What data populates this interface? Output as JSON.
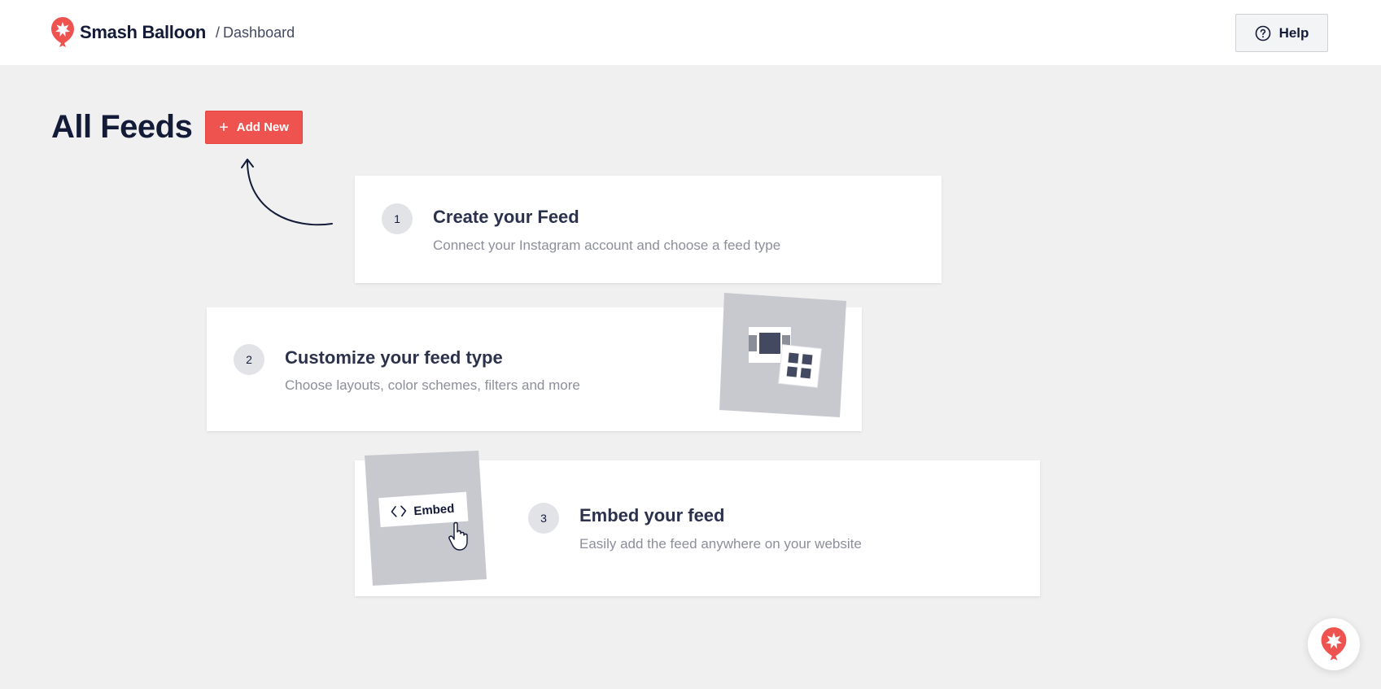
{
  "header": {
    "brand": "Smash Balloon",
    "separator": "/",
    "breadcrumb": "Dashboard",
    "help_label": "Help"
  },
  "main": {
    "title": "All Feeds",
    "add_new_label": "Add New"
  },
  "steps": [
    {
      "number": "1",
      "title": "Create your Feed",
      "description": "Connect your Instagram account and choose a feed type"
    },
    {
      "number": "2",
      "title": "Customize your feed type",
      "description": "Choose layouts, color schemes, filters and more"
    },
    {
      "number": "3",
      "title": "Embed your feed",
      "description": "Easily add the feed anywhere on your website"
    }
  ],
  "illustrations": {
    "embed_chip_label": "Embed"
  },
  "icons": {
    "logo": "smash-balloon-logo",
    "help": "question-circle-icon",
    "add": "plus-icon",
    "pointer": "hand-cursor-icon",
    "code": "code-icon"
  },
  "colors": {
    "accent": "#ef5350",
    "text_dark": "#141b38",
    "text_muted": "#8c8f9a",
    "background": "#f0f0f0"
  }
}
